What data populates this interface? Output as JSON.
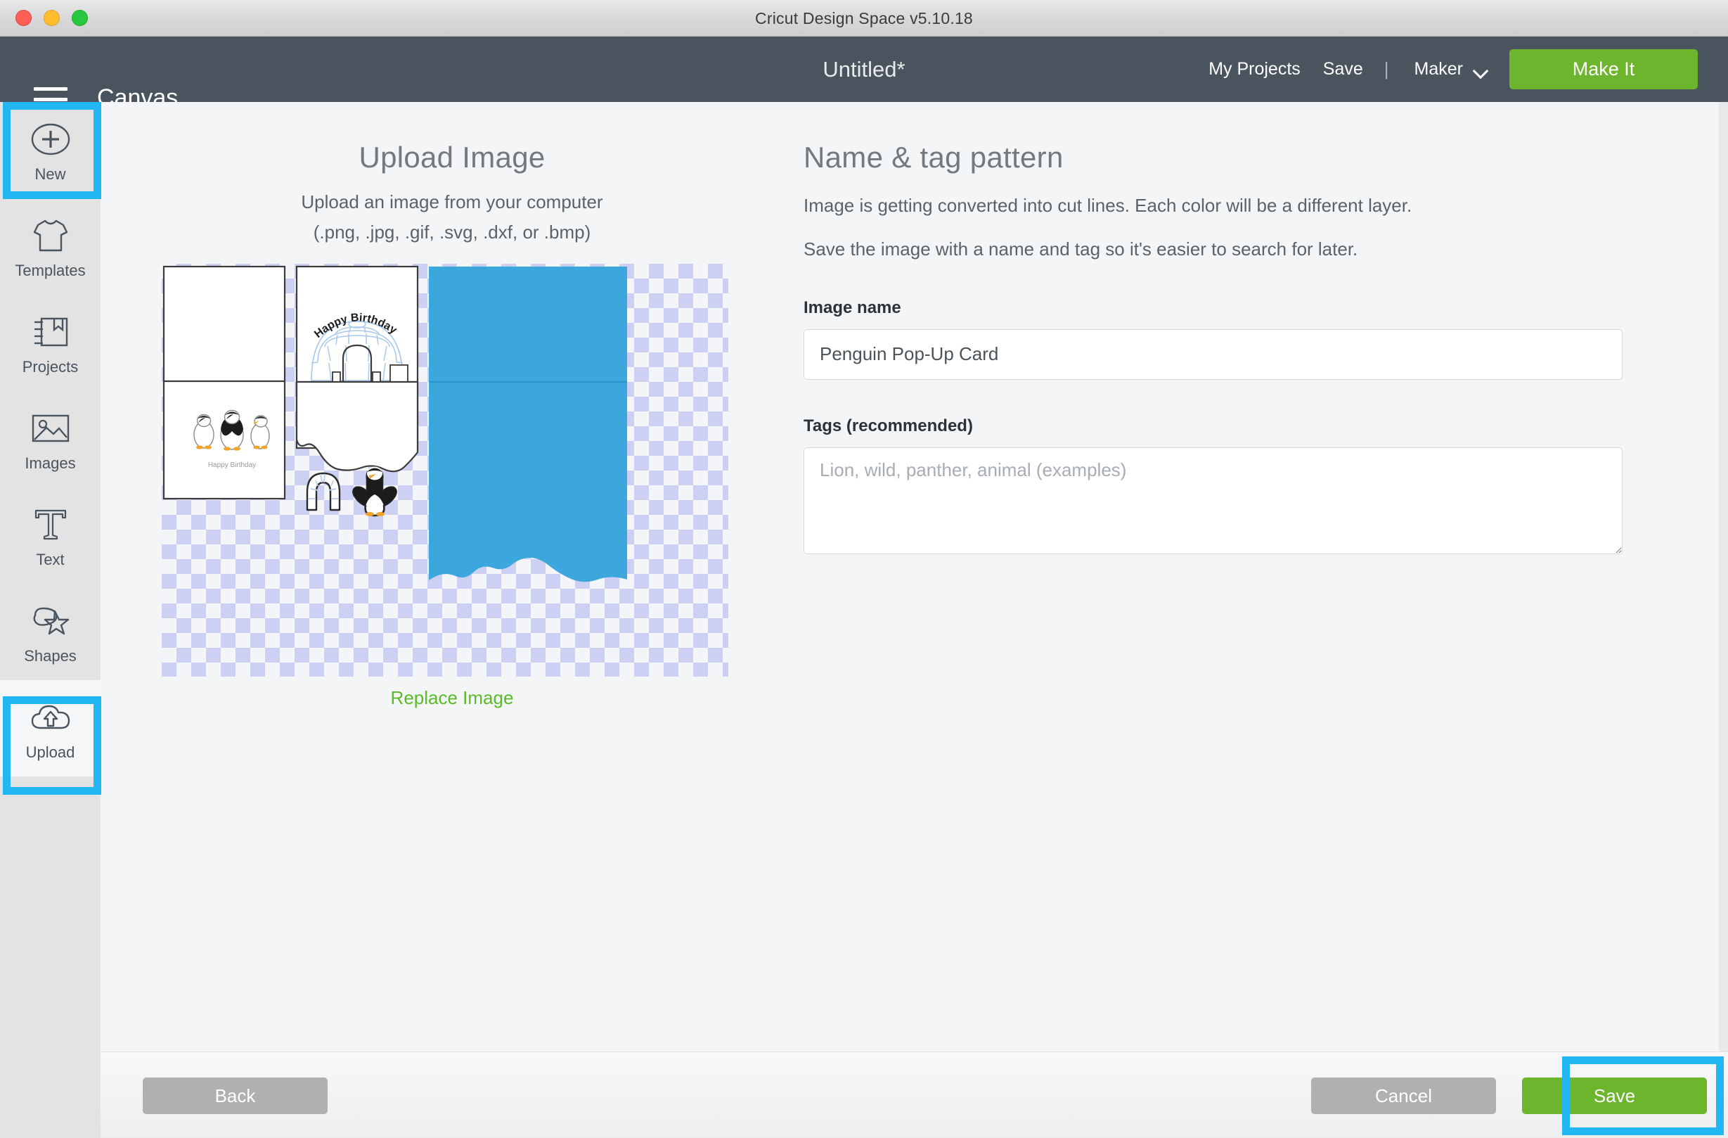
{
  "window": {
    "title": "Cricut Design Space  v5.10.18",
    "traffic_lights": [
      "close-red",
      "minimize-yellow",
      "zoom-green"
    ]
  },
  "appbar": {
    "menu_icon": "hamburger-icon",
    "canvas_label": "Canvas",
    "document_title": "Untitled*",
    "my_projects": "My Projects",
    "save": "Save",
    "separator": "|",
    "machine": "Maker",
    "machine_chevron": "chevron-down-icon",
    "make_it": "Make It",
    "bar_color": "#4a545e",
    "accent_green": "#6cb52d"
  },
  "sidebar": {
    "items": [
      {
        "label": "New",
        "icon": "plus-circle-icon",
        "highlighted": true
      },
      {
        "label": "Templates",
        "icon": "tshirt-icon",
        "highlighted": false
      },
      {
        "label": "Projects",
        "icon": "book-icon",
        "highlighted": false
      },
      {
        "label": "Images",
        "icon": "picture-icon",
        "highlighted": false
      },
      {
        "label": "Text",
        "icon": "text-t-icon",
        "highlighted": false
      },
      {
        "label": "Shapes",
        "icon": "shapes-star-icon",
        "highlighted": false
      },
      {
        "label": "Upload",
        "icon": "cloud-upload-icon",
        "highlighted": true
      }
    ],
    "highlight_color": "#22b7f2"
  },
  "upload_panel": {
    "title": "Upload Image",
    "subtitle": "Upload an image from your computer",
    "formats": "(.png, .jpg, .gif, .svg, .dxf, or .bmp)",
    "replace_link": "Replace Image",
    "replace_link_color": "#5aba28",
    "preview_alt": "penguin-pop-up-card-preview",
    "preview_card_text_outside": "Happy Birthday",
    "preview_card_text_inside": "Happy Birthday",
    "preview_blue_hex": "#3ba7dc",
    "preview_igloo_hex": "#b9d4ef",
    "checker_hex": "#ccd0f2"
  },
  "name_panel": {
    "title": "Name & tag pattern",
    "paragraph_1": "Image is getting converted into cut lines. Each color will be a different layer.",
    "paragraph_2": "Save the image with a name and tag so it's easier to search for later.",
    "image_name_label": "Image name",
    "image_name_value": "Penguin Pop-Up Card",
    "tags_label": "Tags (recommended)",
    "tags_value": "",
    "tags_placeholder": "Lion, wild, panther, animal (examples)"
  },
  "footer": {
    "back": "Back",
    "cancel": "Cancel",
    "save": "Save",
    "save_highlighted": true,
    "disabled_gray": "#b0b0b0",
    "save_green": "#6cb52d"
  }
}
